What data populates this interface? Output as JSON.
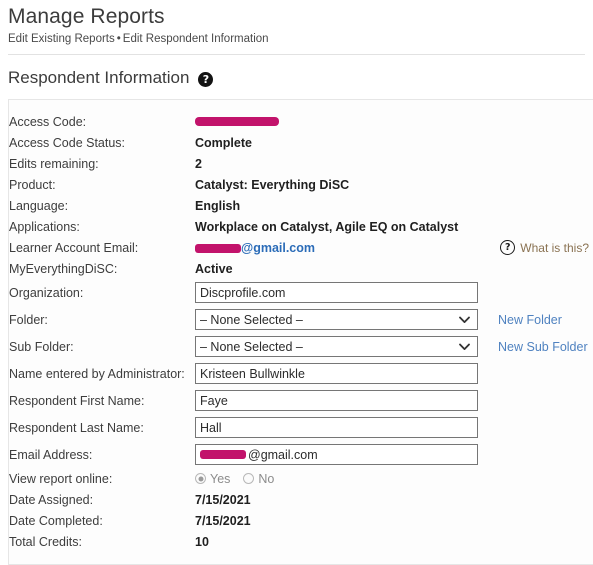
{
  "header": {
    "title": "Manage Reports",
    "breadcrumb_first": "Edit Existing Reports",
    "breadcrumb_sep": "•",
    "breadcrumb_second": "Edit Respondent Information"
  },
  "section": {
    "title": "Respondent Information",
    "help_glyph": "?"
  },
  "colors": {
    "redaction": "#c2136b",
    "link_blue": "#4f82c0",
    "email_blue": "#2b6cb8",
    "whatis_brown": "#8a7252",
    "border": "#767676"
  },
  "static_rows": [
    {
      "label": "Access Code:",
      "value": "",
      "redacted": true
    },
    {
      "label": "Access Code Status:",
      "value": "Complete"
    },
    {
      "label": "Edits remaining:",
      "value": "2"
    },
    {
      "label": "Product:",
      "value": "Catalyst: Everything DiSC"
    },
    {
      "label": "Language:",
      "value": "English"
    },
    {
      "label": "Applications:",
      "value": "Workplace on Catalyst, Agile EQ on Catalyst"
    }
  ],
  "learner_email": {
    "label": "Learner Account Email:",
    "value_suffix": "@gmail.com",
    "whatis_label": "What is this?",
    "whatis_glyph": "?"
  },
  "myeverythingdisc": {
    "label": "MyEverythingDiSC:",
    "value": "Active"
  },
  "fields": {
    "organization": {
      "label": "Organization:",
      "value": "Discprofile.com",
      "placeholder": ""
    },
    "folder": {
      "label": "Folder:",
      "selected": "– None Selected –",
      "options": [
        "– None Selected –"
      ],
      "link": "New Folder"
    },
    "subfolder": {
      "label": "Sub Folder:",
      "selected": "– None Selected –",
      "options": [
        "– None Selected –"
      ],
      "link": "New Sub Folder"
    },
    "admin_name": {
      "label": "Name entered by Administrator:",
      "value": "Kristeen Bullwinkle",
      "placeholder": ""
    },
    "first_name": {
      "label": "Respondent First Name:",
      "value": "Faye",
      "placeholder": ""
    },
    "last_name": {
      "label": "Respondent Last Name:",
      "value": "Hall",
      "placeholder": ""
    },
    "email": {
      "label": "Email Address:",
      "value_suffix": "@gmail.com",
      "placeholder": ""
    }
  },
  "view_report": {
    "label": "View report online:",
    "yes_label": "Yes",
    "no_label": "No",
    "selected": "Yes"
  },
  "footer_rows": [
    {
      "label": "Date Assigned:",
      "value": "7/15/2021"
    },
    {
      "label": "Date Completed:",
      "value": "7/15/2021"
    },
    {
      "label": "Total Credits:",
      "value": "10"
    }
  ]
}
